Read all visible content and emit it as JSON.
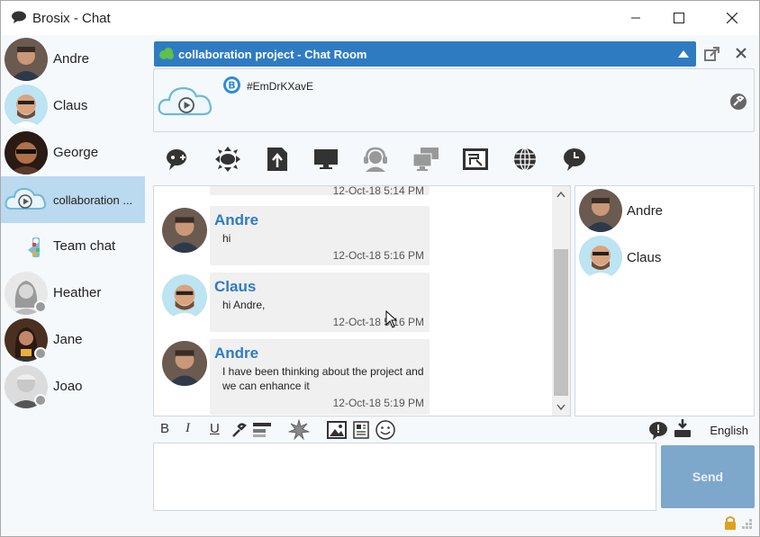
{
  "window": {
    "title": "Brosix - Chat",
    "app_icon": "chat-bubble-icon",
    "controls": [
      "minimize-icon",
      "maximize-icon",
      "close-icon"
    ]
  },
  "sidebar": {
    "items": [
      {
        "label": "Andre",
        "icon": "avatar-photo"
      },
      {
        "label": "Claus",
        "icon": "avatar-photo"
      },
      {
        "label": "George",
        "icon": "avatar-photo"
      },
      {
        "label": "collaboration ...",
        "icon": "cloud-play-icon",
        "selected": true
      },
      {
        "label": "Team chat",
        "icon": "team-chat-icon"
      },
      {
        "label": "Heather",
        "icon": "avatar-photo",
        "status": "offline"
      },
      {
        "label": "Jane",
        "icon": "avatar-photo",
        "status": "offline"
      },
      {
        "label": "Joao",
        "icon": "avatar-photo",
        "status": "offline"
      }
    ]
  },
  "room": {
    "title": "collaboration project - Chat Room",
    "room_id": "#EmDrKXavE",
    "header_icon": "room-cloud-icon"
  },
  "toolbar": {
    "tools": [
      "voice-chat-icon",
      "network-icon",
      "file-upload-icon",
      "screen-share-icon",
      "call-headset-icon",
      "remote-desktop-icon",
      "whiteboard-icon",
      "web-globe-icon",
      "history-icon"
    ]
  },
  "messages": {
    "partial_time": "12-Oct-18 5:14 PM",
    "items": [
      {
        "sender": "Andre",
        "text": "hi",
        "time": "12-Oct-18 5:16 PM"
      },
      {
        "sender": "Claus",
        "text": "hi Andre,",
        "time": "12-Oct-18 5:16 PM"
      },
      {
        "sender": "Andre",
        "text": "I have been thinking about the project and we can enhance it",
        "time": "12-Oct-18 5:19 PM"
      }
    ]
  },
  "participants": {
    "items": [
      {
        "name": "Andre"
      },
      {
        "name": "Claus"
      }
    ]
  },
  "format_bar": {
    "bold": "B",
    "italic": "I",
    "underline": "U",
    "language": "English"
  },
  "compose": {
    "placeholder": "",
    "send_label": "Send"
  },
  "colors": {
    "accent": "#2f7bc2",
    "selected_bg": "#bbd9ef",
    "send_bg": "#7ea7cc",
    "bubble_bg": "#f0f0f0"
  }
}
